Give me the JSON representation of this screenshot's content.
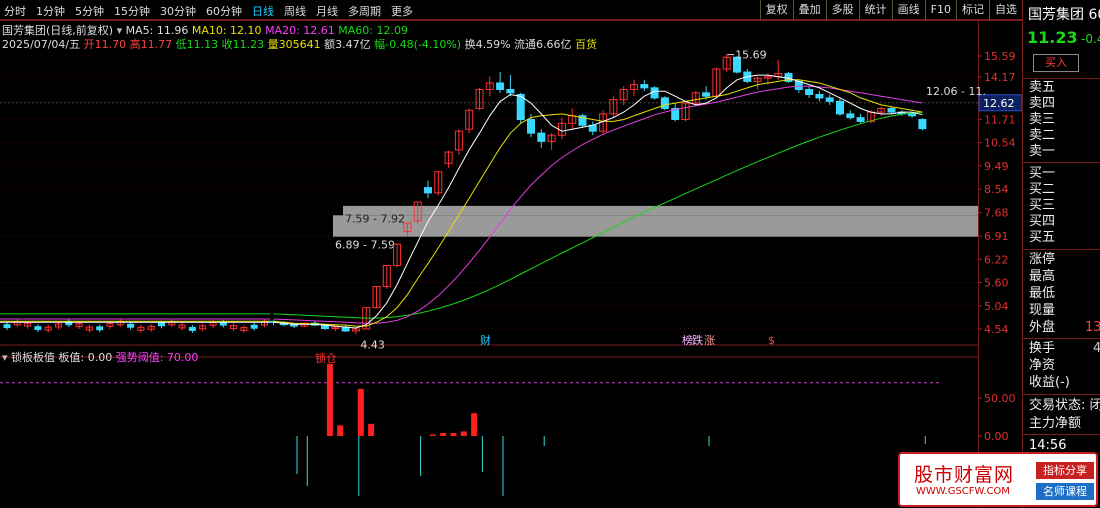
{
  "toolbar": {
    "periods": [
      "分时",
      "1分钟",
      "5分钟",
      "15分钟",
      "30分钟",
      "60分钟",
      "日线",
      "周线",
      "月线",
      "多周期",
      "更多"
    ],
    "active_period": "日线",
    "tools": [
      "复权",
      "叠加",
      "多股",
      "统计",
      "画线",
      "F10",
      "标记",
      "自选"
    ]
  },
  "info": {
    "title": "国芳集团(日线,前复权)",
    "ma5": "MA5: 11.96",
    "ma10": "MA10: 12.10",
    "ma20": "MA20: 12.61",
    "ma60": "MA60: 12.09",
    "date": "2025/07/04/五",
    "open": "开11.70",
    "high": "高11.77",
    "low": "低11.13",
    "close": "收11.23",
    "volume": "量305641",
    "amount": "额3.47亿",
    "amplitude": "幅-0.48(-4.10%)",
    "turnover": "换4.59%",
    "float": "流通6.66亿",
    "category": "百货"
  },
  "indicator": {
    "name": "锁板板值",
    "value": "板值: 0.00",
    "threshold": "强势阈值: 70.00",
    "marker": "锁仓"
  },
  "price_axis": [
    "15.59",
    "14.17",
    "12.62",
    "11.71",
    "10.54",
    "9.49",
    "8.54",
    "7.68",
    "6.91",
    "6.22",
    "5.60",
    "5.04",
    "4.54"
  ],
  "ind_axis": [
    "50.00",
    "0.00"
  ],
  "annotations": {
    "peak": "15.69",
    "low": "4.43",
    "range1": "7.59 - 7.92",
    "range2": "6.89 - 7.59",
    "ma_tag": "12.06 - 11.",
    "cur_price_tag": "12.62",
    "events": [
      "财",
      "榜",
      "跌",
      "涨",
      "$"
    ]
  },
  "right_panel": {
    "name": "国芳集团 60",
    "price": "11.23",
    "change": "-0.4",
    "buy_btn": "买入",
    "sell": [
      "卖五",
      "卖四",
      "卖三",
      "卖二",
      "卖一"
    ],
    "buy": [
      "买一",
      "买二",
      "买三",
      "买四",
      "买五"
    ],
    "stats1": [
      "涨停",
      "最高",
      "最低",
      "现量"
    ],
    "outer_label": "外盘",
    "outer_value": "13",
    "stats2": [
      "换手",
      "净资",
      "收益(-)"
    ],
    "turnover_value": "4",
    "trade_status": "交易状态: 闭",
    "main_flow": "主力净额",
    "time": "14:56"
  },
  "watermark": {
    "main": "股市财富网",
    "url": "WWW.GSCFW.COM",
    "tag1": "指标分享",
    "tag2": "名师课程"
  },
  "chart_data": {
    "type": "candlestick",
    "ylim": [
      4.54,
      15.59
    ],
    "candles": [
      [
        4.7,
        4.72,
        4.62,
        4.68
      ],
      [
        4.68,
        4.7,
        4.6,
        4.63
      ],
      [
        4.63,
        4.66,
        4.56,
        4.6
      ],
      [
        4.6,
        4.68,
        4.58,
        4.66
      ],
      [
        4.66,
        4.7,
        4.6,
        4.62
      ],
      [
        4.62,
        4.64,
        4.52,
        4.55
      ],
      [
        4.55,
        4.6,
        4.5,
        4.58
      ],
      [
        4.58,
        4.62,
        4.48,
        4.5
      ],
      [
        4.5,
        4.56,
        4.43,
        4.54
      ],
      [
        4.54,
        5.0,
        4.54,
        5.0
      ],
      [
        5.0,
        5.5,
        5.0,
        5.5
      ],
      [
        5.5,
        6.05,
        5.45,
        6.05
      ],
      [
        6.05,
        6.66,
        6.0,
        6.66
      ],
      [
        7.05,
        7.33,
        6.9,
        7.33
      ],
      [
        7.4,
        8.06,
        7.3,
        8.06
      ],
      [
        8.6,
        8.87,
        8.2,
        8.4
      ],
      [
        8.4,
        9.24,
        8.3,
        9.24
      ],
      [
        9.6,
        10.16,
        9.4,
        10.1
      ],
      [
        10.2,
        11.2,
        10.0,
        11.1
      ],
      [
        11.2,
        12.3,
        11.0,
        12.2
      ],
      [
        12.3,
        13.5,
        12.2,
        13.4
      ],
      [
        13.4,
        14.2,
        13.0,
        13.8
      ],
      [
        13.8,
        14.5,
        13.2,
        13.4
      ],
      [
        13.4,
        14.3,
        13.0,
        13.2
      ],
      [
        13.1,
        13.2,
        11.5,
        11.7
      ],
      [
        11.7,
        12.0,
        10.8,
        11.0
      ],
      [
        11.0,
        11.2,
        10.3,
        10.6
      ],
      [
        10.6,
        11.0,
        10.2,
        10.9
      ],
      [
        10.9,
        11.8,
        10.7,
        11.5
      ],
      [
        11.5,
        12.3,
        11.2,
        11.9
      ],
      [
        11.9,
        12.0,
        11.3,
        11.4
      ],
      [
        11.4,
        11.6,
        10.9,
        11.1
      ],
      [
        11.1,
        12.2,
        11.0,
        12.0
      ],
      [
        12.0,
        13.0,
        11.8,
        12.8
      ],
      [
        12.8,
        13.6,
        12.5,
        13.4
      ],
      [
        13.4,
        14.0,
        13.0,
        13.7
      ],
      [
        13.7,
        14.0,
        13.3,
        13.5
      ],
      [
        13.5,
        13.6,
        12.8,
        12.9
      ],
      [
        12.9,
        13.0,
        12.2,
        12.3
      ],
      [
        12.3,
        12.6,
        11.6,
        11.7
      ],
      [
        11.7,
        12.7,
        11.6,
        12.6
      ],
      [
        12.6,
        13.3,
        12.4,
        13.2
      ],
      [
        13.2,
        13.6,
        12.8,
        13.0
      ],
      [
        13.0,
        14.8,
        12.9,
        14.7
      ],
      [
        14.7,
        15.69,
        14.5,
        15.5
      ],
      [
        15.5,
        15.6,
        14.4,
        14.5
      ],
      [
        14.5,
        14.7,
        13.8,
        13.9
      ],
      [
        13.9,
        14.2,
        13.4,
        14.1
      ],
      [
        14.1,
        14.4,
        13.7,
        14.2
      ],
      [
        14.2,
        15.3,
        14.0,
        14.4
      ],
      [
        14.4,
        14.5,
        13.8,
        13.9
      ],
      [
        13.9,
        14.0,
        13.2,
        13.4
      ],
      [
        13.4,
        13.6,
        12.9,
        13.1
      ],
      [
        13.1,
        13.3,
        12.7,
        12.9
      ],
      [
        12.9,
        13.1,
        12.5,
        12.7
      ],
      [
        12.7,
        12.9,
        11.9,
        12.0
      ],
      [
        12.0,
        12.2,
        11.7,
        11.8
      ],
      [
        11.8,
        12.0,
        11.5,
        11.6
      ],
      [
        11.6,
        12.2,
        11.5,
        12.1
      ],
      [
        12.1,
        12.4,
        11.9,
        12.3
      ],
      [
        12.3,
        12.4,
        12.0,
        12.1
      ],
      [
        12.1,
        12.2,
        11.9,
        12.0
      ],
      [
        12.0,
        12.1,
        11.8,
        11.9
      ],
      [
        11.7,
        11.77,
        11.13,
        11.23
      ]
    ],
    "ma5": [
      4.68,
      4.66,
      4.64,
      4.64,
      4.64,
      4.62,
      4.6,
      4.58,
      4.56,
      4.63,
      4.82,
      5.11,
      5.55,
      6.11,
      6.72,
      7.38,
      7.94,
      8.6,
      9.38,
      10.21,
      11.0,
      11.9,
      12.7,
      13.1,
      13.0,
      12.6,
      12.0,
      11.4,
      11.1,
      11.2,
      11.3,
      11.4,
      11.6,
      11.8,
      12.1,
      12.5,
      13.0,
      13.3,
      13.3,
      13.0,
      12.7,
      12.5,
      12.6,
      12.9,
      13.5,
      14.0,
      14.2,
      14.3,
      14.3,
      14.2,
      14.1,
      13.9,
      13.7,
      13.5,
      13.2,
      12.9,
      12.6,
      12.3,
      12.1,
      12.0,
      12.0,
      12.1,
      12.1,
      11.96
    ],
    "ma10": [
      4.7,
      4.68,
      4.66,
      4.65,
      4.65,
      4.64,
      4.63,
      4.62,
      4.6,
      4.6,
      4.68,
      4.8,
      5.0,
      5.3,
      5.7,
      6.1,
      6.55,
      7.05,
      7.6,
      8.2,
      8.85,
      9.55,
      10.3,
      11.0,
      11.5,
      11.8,
      11.9,
      11.95,
      12.0,
      11.9,
      11.8,
      11.7,
      11.6,
      11.6,
      11.7,
      11.9,
      12.1,
      12.3,
      12.5,
      12.6,
      12.7,
      12.8,
      12.9,
      13.0,
      13.1,
      13.3,
      13.5,
      13.7,
      13.8,
      13.9,
      14.0,
      14.0,
      13.9,
      13.8,
      13.6,
      13.4,
      13.2,
      12.9,
      12.7,
      12.5,
      12.4,
      12.3,
      12.2,
      12.1
    ],
    "ma20": [
      4.75,
      4.74,
      4.73,
      4.72,
      4.71,
      4.7,
      4.69,
      4.68,
      4.67,
      4.66,
      4.66,
      4.68,
      4.72,
      4.8,
      4.92,
      5.08,
      5.28,
      5.52,
      5.8,
      6.12,
      6.48,
      6.88,
      7.32,
      7.8,
      8.25,
      8.7,
      9.1,
      9.5,
      9.85,
      10.15,
      10.45,
      10.7,
      10.95,
      11.15,
      11.35,
      11.55,
      11.75,
      11.95,
      12.1,
      12.25,
      12.35,
      12.45,
      12.55,
      12.65,
      12.8,
      12.95,
      13.1,
      13.25,
      13.35,
      13.45,
      13.55,
      13.6,
      13.6,
      13.55,
      13.5,
      13.4,
      13.3,
      13.2,
      13.1,
      13.0,
      12.9,
      12.8,
      12.7,
      12.61
    ],
    "ma60": [
      4.86,
      4.85,
      4.84,
      4.83,
      4.82,
      4.81,
      4.8,
      4.79,
      4.78,
      4.77,
      4.77,
      4.78,
      4.8,
      4.83,
      4.87,
      4.92,
      4.98,
      5.05,
      5.13,
      5.22,
      5.32,
      5.43,
      5.55,
      5.68,
      5.82,
      5.96,
      6.1,
      6.25,
      6.4,
      6.55,
      6.7,
      6.86,
      7.02,
      7.18,
      7.35,
      7.52,
      7.69,
      7.86,
      8.03,
      8.2,
      8.37,
      8.55,
      8.73,
      8.91,
      9.1,
      9.29,
      9.48,
      9.67,
      9.86,
      10.05,
      10.24,
      10.43,
      10.62,
      10.8,
      10.98,
      11.15,
      11.32,
      11.48,
      11.63,
      11.77,
      11.89,
      11.98,
      12.05,
      12.09
    ],
    "ind_pos": [
      {
        "i": 43,
        "v": 95
      },
      {
        "i": 44,
        "v": 14
      },
      {
        "i": 46,
        "v": 62
      },
      {
        "i": 47,
        "v": 16
      },
      {
        "i": 53,
        "v": 2
      },
      {
        "i": 54,
        "v": 4
      },
      {
        "i": 55,
        "v": 4
      },
      {
        "i": 56,
        "v": 6
      },
      {
        "i": 57,
        "v": 30
      }
    ],
    "ind_neg": [
      {
        "i": 40,
        "v": 38
      },
      {
        "i": 41,
        "v": 50
      },
      {
        "i": 46,
        "v": 60
      },
      {
        "i": 52,
        "v": 40
      },
      {
        "i": 58,
        "v": 36
      },
      {
        "i": 60,
        "v": 60
      },
      {
        "i": 64,
        "v": 10
      },
      {
        "i": 80,
        "v": 10
      },
      {
        "i": 101,
        "v": 8
      },
      {
        "i": 118,
        "v": 18
      },
      {
        "i": 125,
        "v": 8
      }
    ],
    "ind_threshold": 70
  }
}
